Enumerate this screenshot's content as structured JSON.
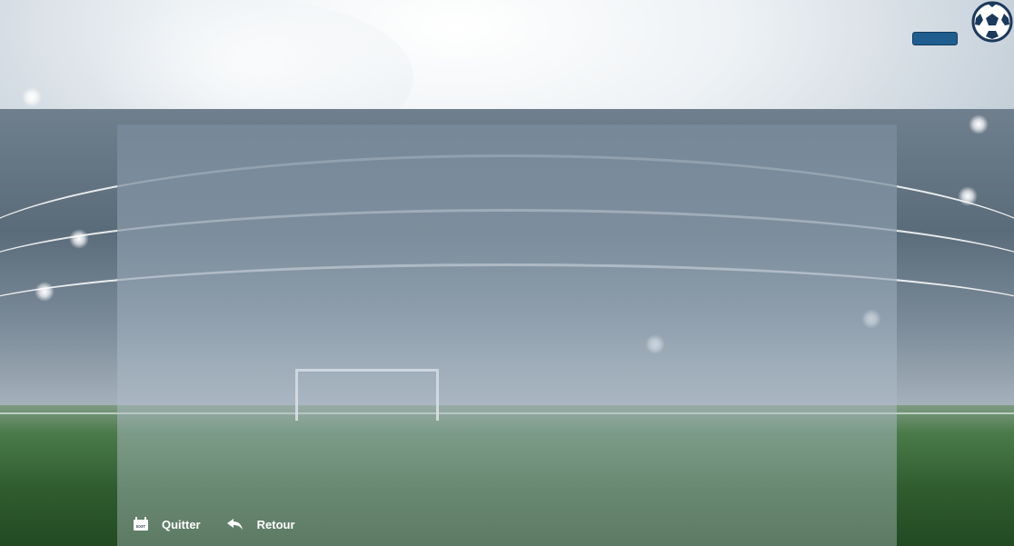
{
  "header": {
    "menu_button": "menu-button",
    "logo_icon": "soccer-ball-icon"
  },
  "footer": {
    "quit": {
      "label": "Quitter",
      "icon": "exit-icon",
      "icon_text": "EXIT"
    },
    "back": {
      "label": "Retour",
      "icon": "back-arrow-icon"
    }
  },
  "colors": {
    "accent": "#1f5d8f",
    "text": "#ffffff"
  }
}
